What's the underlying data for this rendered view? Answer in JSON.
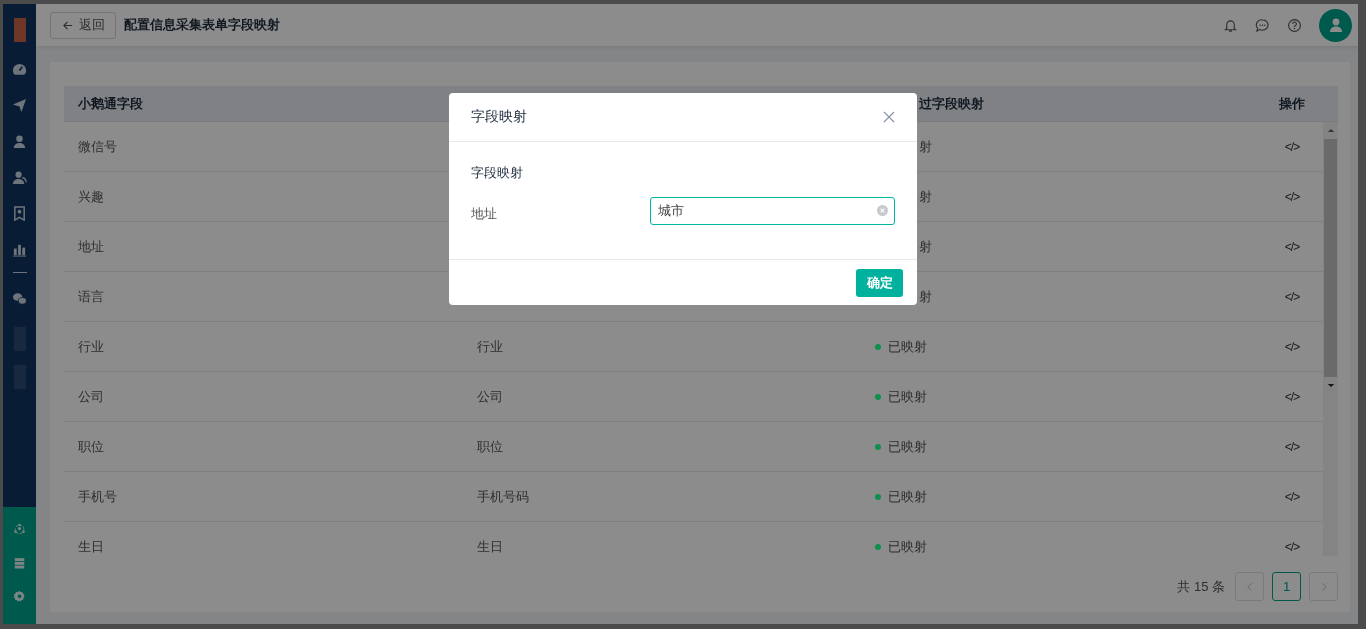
{
  "header": {
    "back_button": "返回",
    "title": "配置信息采集表单字段映射"
  },
  "table": {
    "columns": {
      "column_1": "小鹅通字段",
      "column_3": "过字段映射",
      "column_4": "操作"
    },
    "rows": [
      {
        "kind": "covered",
        "field": "微信号",
        "status": "射",
        "action": "</>"
      },
      {
        "kind": "covered",
        "field": "兴趣",
        "status": "射",
        "action": "</>"
      },
      {
        "kind": "covered",
        "field": "地址",
        "status": "射",
        "action": "</>"
      },
      {
        "kind": "covered",
        "field": "语言",
        "status": "射",
        "action": "</>"
      },
      {
        "kind": "full",
        "field": "行业",
        "mapped_field": "行业",
        "status": "已映射",
        "color": "#0e8f4e",
        "action": "</>"
      },
      {
        "kind": "full",
        "field": "公司",
        "mapped_field": "公司",
        "status": "已映射",
        "color": "#0e8f4e",
        "action": "</>"
      },
      {
        "kind": "full",
        "field": "职位",
        "mapped_field": "职位",
        "status": "已映射",
        "color": "#0e8f4e",
        "action": "</>"
      },
      {
        "kind": "full",
        "field": "手机号",
        "mapped_field": "手机号码",
        "status": "已映射",
        "color": "#0e8f4e",
        "action": "</>"
      },
      {
        "kind": "full",
        "field": "生日",
        "mapped_field": "生日",
        "status": "已映射",
        "color": "#0e8f4e",
        "action": "</>"
      }
    ]
  },
  "pagination": {
    "total": "共 15 条",
    "pages": [
      {
        "label": "1",
        "selected": true
      }
    ]
  },
  "modal": {
    "title": "字段映射",
    "section_label": "字段映射",
    "field_label": "地址",
    "field_value": "城市",
    "confirm_button": "确定"
  }
}
